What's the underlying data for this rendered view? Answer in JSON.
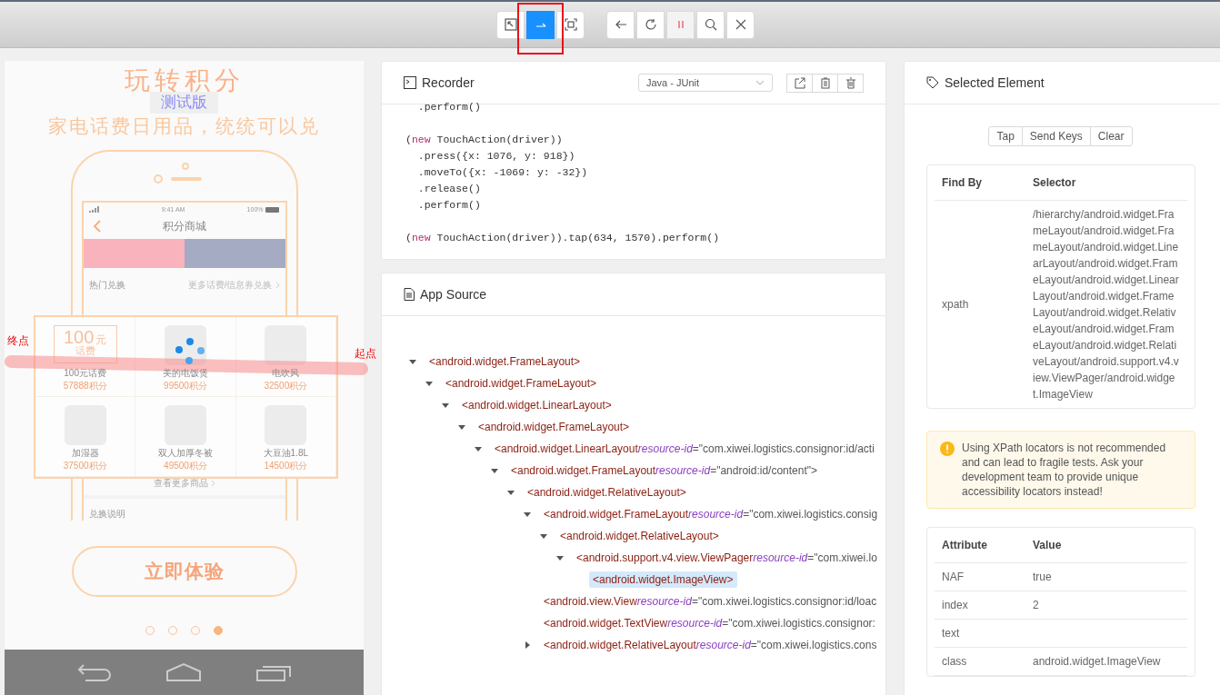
{
  "toolbar": {
    "groups": [
      {
        "buttons": [
          {
            "selected": false,
            "annotated": false
          },
          {
            "selected": true,
            "annotated": true
          },
          {
            "selected": false,
            "annotated": false
          }
        ]
      },
      {
        "buttons": [
          {
            "selected": false,
            "annotated": false
          },
          {
            "selected": false,
            "annotated": false
          },
          {
            "selected": true,
            "annotated": false
          },
          {
            "selected": false,
            "annotated": false
          },
          {
            "selected": false,
            "annotated": false
          }
        ]
      }
    ]
  },
  "device": {
    "headline": "玩转积分",
    "badge": "测试版",
    "subtitle": "家电话费日用品，统统可以兑",
    "status_time": "9:41 AM",
    "battery": "100%",
    "screen_title": "积分商城",
    "section": "热门兑换",
    "section_link": "更多话费/信息券兑换",
    "products": [
      {
        "name": "100元话费",
        "points": "57888积分",
        "coupon": {
          "amount": "100",
          "unit": "元",
          "label": "话费"
        }
      },
      {
        "name": "美的电饭煲",
        "points": "99500积分"
      },
      {
        "name": "电吹风",
        "points": "32500积分"
      },
      {
        "name": "加湿器",
        "points": "37500积分"
      },
      {
        "name": "双人加厚冬被",
        "points": "49500积分"
      },
      {
        "name": "大豆油1.8L",
        "points": "14500积分"
      }
    ],
    "more_link": "查看更多商品",
    "info": "兑换说明",
    "cta": "立即体验",
    "page_dots": [
      {
        "selected": false
      },
      {
        "selected": false
      },
      {
        "selected": false
      },
      {
        "selected": true
      }
    ],
    "gesture": {
      "end_label": "终点",
      "start_label": "起点"
    }
  },
  "recorder": {
    "title": "Recorder",
    "language": "Java - JUnit",
    "code": [
      {
        "gap": false,
        "parts": [
          {
            "kind": "plain",
            "text": "  .perform()"
          }
        ]
      },
      {
        "gap": true,
        "parts": [
          {
            "kind": "plain",
            "text": "("
          },
          {
            "kind": "keyword",
            "text": "new"
          },
          {
            "kind": "plain",
            "text": " TouchAction(driver))"
          }
        ]
      },
      {
        "gap": false,
        "parts": [
          {
            "kind": "plain",
            "text": "  .press({x: 1076, y: 918})"
          }
        ]
      },
      {
        "gap": false,
        "parts": [
          {
            "kind": "plain",
            "text": "  .moveTo({x: -1069: y: -32})"
          }
        ]
      },
      {
        "gap": false,
        "parts": [
          {
            "kind": "plain",
            "text": "  .release()"
          }
        ]
      },
      {
        "gap": false,
        "parts": [
          {
            "kind": "plain",
            "text": "  .perform()"
          }
        ]
      },
      {
        "gap": true,
        "parts": [
          {
            "kind": "plain",
            "text": "("
          },
          {
            "kind": "keyword",
            "text": "new"
          },
          {
            "kind": "plain",
            "text": " TouchAction(driver)).tap(634, 1570).perform()"
          }
        ]
      }
    ]
  },
  "source": {
    "title": "App Source",
    "tree": [
      {
        "tag": "<android.widget.FrameLayout>",
        "expanded": true,
        "selected": false,
        "children": [
          {
            "tag": "<android.widget.FrameLayout>",
            "expanded": true,
            "selected": false,
            "children": [
              {
                "tag": "<android.widget.LinearLayout>",
                "expanded": true,
                "selected": false,
                "children": [
                  {
                    "tag": "<android.widget.FrameLayout>",
                    "expanded": true,
                    "selected": false,
                    "children": [
                      {
                        "tag": "<android.widget.LinearLayout",
                        "attr": "resource-id",
                        "value": "=\"com.xiwei.logistics.consignor:id/acti",
                        "expanded": true,
                        "selected": false,
                        "children": [
                          {
                            "tag": "<android.widget.FrameLayout",
                            "attr": "resource-id",
                            "value": "=\"android:id/content\">",
                            "expanded": true,
                            "selected": false,
                            "children": [
                              {
                                "tag": "<android.widget.RelativeLayout>",
                                "expanded": true,
                                "selected": false,
                                "children": [
                                  {
                                    "tag": "<android.widget.FrameLayout",
                                    "attr": "resource-id",
                                    "value": "=\"com.xiwei.logistics.consig",
                                    "expanded": true,
                                    "selected": false,
                                    "children": [
                                      {
                                        "tag": "<android.widget.RelativeLayout>",
                                        "expanded": true,
                                        "selected": false,
                                        "children": [
                                          {
                                            "tag": "<android.support.v4.view.ViewPager",
                                            "attr": "resource-id",
                                            "value": "=\"com.xiwei.lo",
                                            "expanded": true,
                                            "selected": false,
                                            "children": [
                                              {
                                                "tag": "<android.widget.ImageView>",
                                                "selected": true
                                              }
                                            ]
                                          }
                                        ]
                                      }
                                    ]
                                  },
                                  {
                                    "tag": "<android.view.View",
                                    "attr": "resource-id",
                                    "value": "=\"com.xiwei.logistics.consignor:id/loac",
                                    "selected": false
                                  },
                                  {
                                    "tag": "<android.widget.TextView",
                                    "attr": "resource-id",
                                    "value": "=\"com.xiwei.logistics.consignor:",
                                    "selected": false
                                  },
                                  {
                                    "tag": "<android.widget.RelativeLayout",
                                    "attr": "resource-id",
                                    "value": "=\"com.xiwei.logistics.cons",
                                    "expanded": false,
                                    "selected": false
                                  }
                                ]
                              }
                            ]
                          }
                        ]
                      }
                    ]
                  }
                ]
              }
            ]
          }
        ]
      }
    ]
  },
  "selected_element": {
    "title": "Selected Element",
    "actions": [
      "Tap",
      "Send Keys",
      "Clear"
    ],
    "find_by": {
      "columns": [
        "Find By",
        "Selector"
      ],
      "rows": [
        {
          "by": "xpath",
          "selector": "/hierarchy/android.widget.FrameLayout/android.widget.FrameLayout/android.widget.LinearLayout/android.widget.FrameLayout/android.widget.LinearLayout/android.widget.FrameLayout/android.widget.RelativeLayout/android.widget.FrameLayout/android.widget.RelativeLayout/android.support.v4.view.ViewPager/android.widget.ImageView"
        }
      ]
    },
    "warning": "Using XPath locators is not recommended and can lead to fragile tests. Ask your development team to provide unique accessibility locators instead!",
    "attributes": {
      "columns": [
        "Attribute",
        "Value"
      ],
      "rows": [
        {
          "name": "NAF",
          "value": "true"
        },
        {
          "name": "index",
          "value": "2"
        },
        {
          "name": "text"
        },
        {
          "name": "class",
          "value": "android.widget.ImageView"
        }
      ]
    }
  }
}
